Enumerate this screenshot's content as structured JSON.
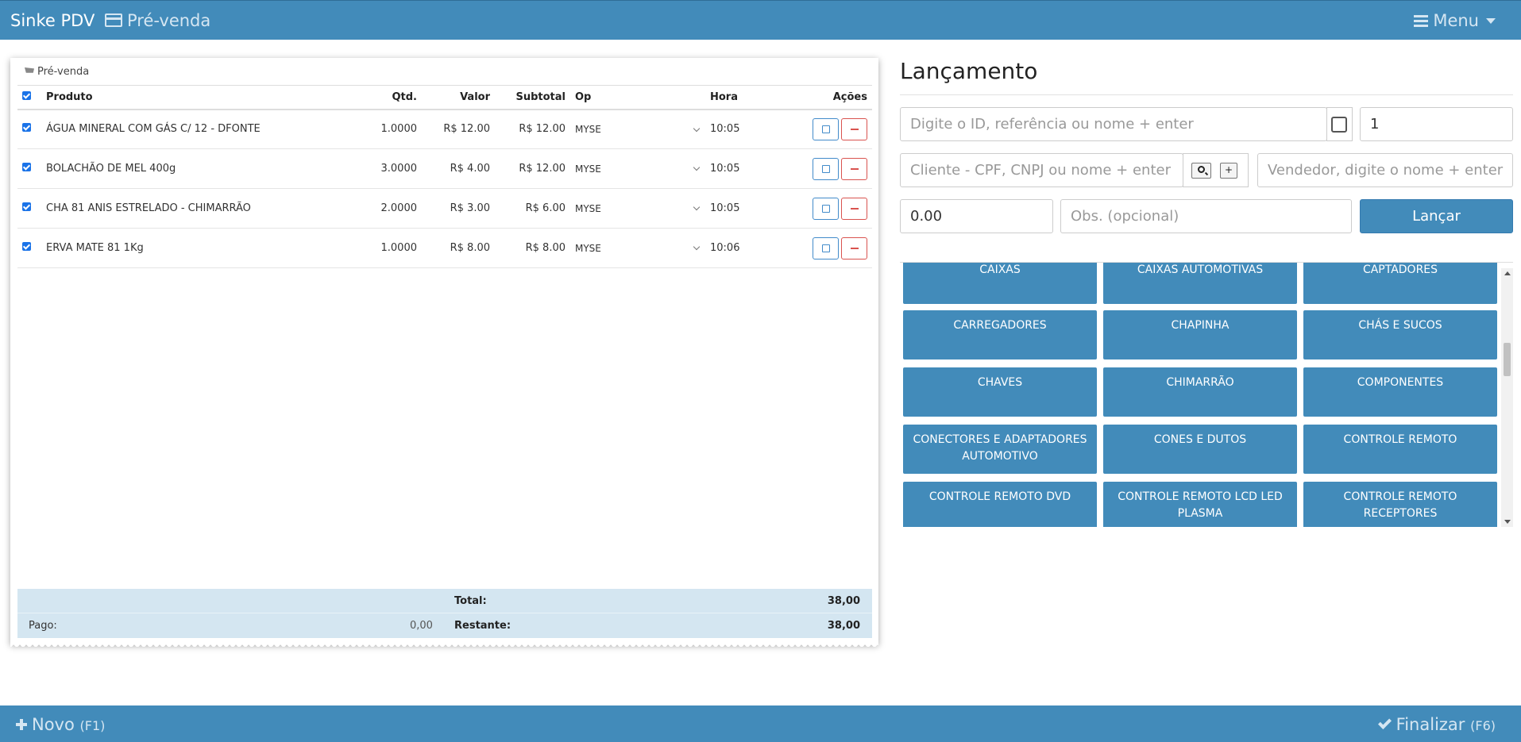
{
  "navbar": {
    "brand": "Sinke PDV",
    "section": "Pré-venda",
    "menu": "Menu"
  },
  "panel": {
    "title": "Pré-venda",
    "columns": {
      "produto": "Produto",
      "qtd": "Qtd.",
      "valor": "Valor",
      "subtotal": "Subtotal",
      "op": "Op",
      "hora": "Hora",
      "acoes": "Ações"
    },
    "rows": [
      {
        "produto": "ÁGUA MINERAL COM GÁS C/ 12 - DFONTE",
        "qtd": "1.0000",
        "valor": "R$ 12.00",
        "subtotal": "R$ 12.00",
        "op": "MYSE",
        "hora": "10:05"
      },
      {
        "produto": "BOLACHÃO DE MEL 400g",
        "qtd": "3.0000",
        "valor": "R$ 4.00",
        "subtotal": "R$ 12.00",
        "op": "MYSE",
        "hora": "10:05"
      },
      {
        "produto": "CHA 81 ANIS ESTRELADO - CHIMARRÃO",
        "qtd": "2.0000",
        "valor": "R$ 3.00",
        "subtotal": "R$ 6.00",
        "op": "MYSE",
        "hora": "10:05"
      },
      {
        "produto": "ERVA MATE 81 1Kg",
        "qtd": "1.0000",
        "valor": "R$ 8.00",
        "subtotal": "R$ 8.00",
        "op": "MYSE",
        "hora": "10:06"
      }
    ],
    "totals": {
      "total_label": "Total:",
      "total_value": "38,00",
      "pago_label": "Pago:",
      "pago_value": "0,00",
      "restante_label": "Restante:",
      "restante_value": "38,00"
    }
  },
  "lancamento": {
    "title": "Lançamento",
    "search_placeholder": "Digite o ID, referência ou nome + enter",
    "quantity_value": "1",
    "cliente_placeholder": "Cliente - CPF, CNPJ ou nome + enter",
    "add_client_label": "+",
    "vendedor_placeholder": "Vendedor, digite o nome + enter",
    "price_value": "0.00",
    "obs_placeholder": "Obs. (opcional)",
    "submit_label": "Lançar"
  },
  "categories": [
    "CAIXAS",
    "CAIXAS AUTOMOTIVAS",
    "CAPTADORES",
    "CARREGADORES",
    "CHAPINHA",
    "CHÁS E SUCOS",
    "CHAVES",
    "CHIMARRÃO",
    "COMPONENTES",
    "CONECTORES E ADAPTADORES AUTOMOTIVO",
    "CONES E DUTOS",
    "CONTROLE REMOTO",
    "CONTROLE REMOTO DVD",
    "CONTROLE REMOTO LCD LED PLASMA",
    "CONTROLE REMOTO RECEPTORES"
  ],
  "footer": {
    "novo": "Novo",
    "novo_key": "(F1)",
    "finalizar": "Finalizar",
    "finalizar_key": "(F6)"
  },
  "colors": {
    "primary": "#428bba",
    "danger": "#d9534f",
    "totals_bg": "#d4e6f1"
  }
}
